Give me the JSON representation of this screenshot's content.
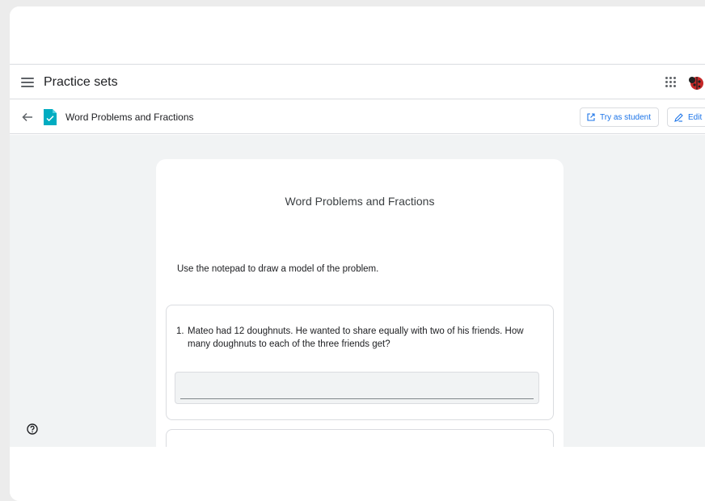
{
  "appbar": {
    "title": "Practice sets",
    "menu_icon": "hamburger-menu-icon",
    "apps_icon": "google-apps-grid-icon",
    "avatar_icon": "ladybug-avatar"
  },
  "toolbar": {
    "back_icon": "arrow-back-icon",
    "doc_icon": "practice-set-check-icon",
    "doc_title": "Word Problems and Fractions",
    "try_label": "Try as student",
    "edit_label": "Edit"
  },
  "card": {
    "title": "Word Problems and Fractions",
    "instructions": "Use the notepad to draw a model of the problem.",
    "questions": [
      {
        "number": "1.",
        "text": "Mateo had 12 doughnuts. He wanted to share equally with two of his friends. How many doughnuts to each of the three friends get?"
      }
    ]
  },
  "colors": {
    "accent": "#1a73e8",
    "doc_icon": "#00acc1",
    "background": "#f1f3f4"
  }
}
